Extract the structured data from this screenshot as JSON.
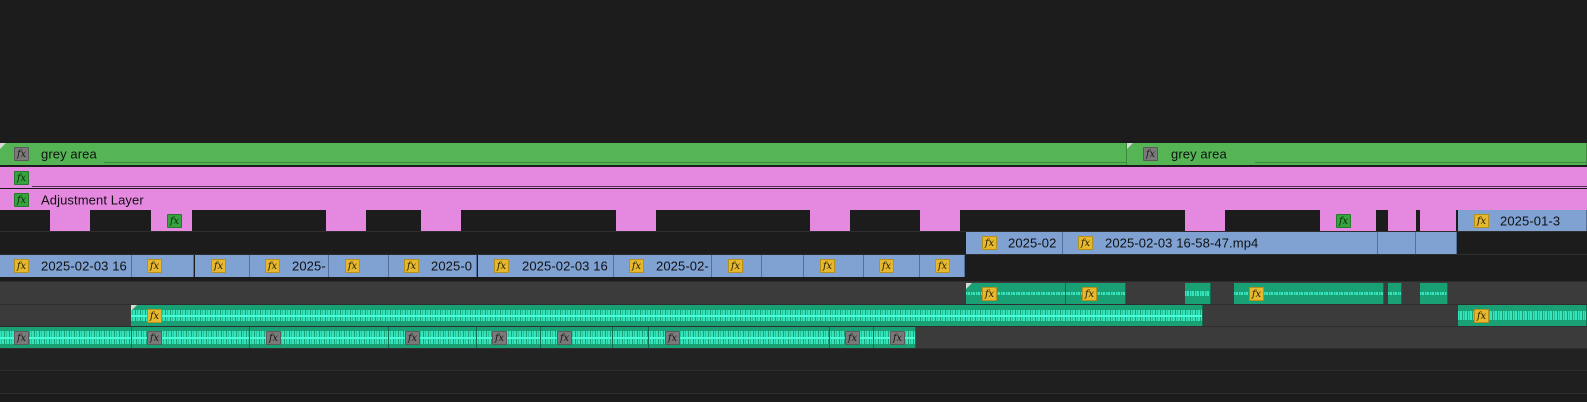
{
  "colors": {
    "background": "#1c1c1c",
    "track_audio_bg": "#3b3b3b",
    "clip_green": "#55b555",
    "clip_pink": "#e588e0",
    "clip_blue": "#7fa2d2",
    "clip_audio": "#1aa075",
    "fx_gray": "#7a7a7a",
    "fx_green": "#37a33f",
    "fx_yellow": "#e6b830"
  },
  "tracks": {
    "v6": {
      "clips": [
        {
          "label": "grey area",
          "fx": "gray"
        },
        {
          "label": "grey area",
          "fx": "gray"
        }
      ]
    },
    "v5": {
      "clips": [
        {
          "label": "",
          "fx": "green"
        }
      ]
    },
    "v4": {
      "clips": [
        {
          "label": "Adjustment Layer",
          "fx": "green"
        }
      ]
    },
    "v3": {
      "clips": [
        {
          "label": "",
          "fx": ""
        },
        {
          "label": "",
          "fx": "green"
        },
        {
          "label": "",
          "fx": ""
        },
        {
          "label": "",
          "fx": ""
        },
        {
          "label": "",
          "fx": ""
        },
        {
          "label": "",
          "fx": ""
        },
        {
          "label": "",
          "fx": ""
        },
        {
          "label": "",
          "fx": ""
        },
        {
          "label": "",
          "fx": "green"
        },
        {
          "label": "",
          "fx": ""
        },
        {
          "label": "",
          "fx": ""
        },
        {
          "label": "2025-01-3",
          "fx": "yellow"
        }
      ]
    },
    "v2": {
      "clips": [
        {
          "label": "2025-02",
          "fx": "yellow"
        },
        {
          "label": "2025-02-03 16-58-47.mp4",
          "fx": "yellow"
        },
        {
          "label": "",
          "fx": ""
        },
        {
          "label": "",
          "fx": ""
        }
      ]
    },
    "v1": {
      "clips": [
        {
          "label": "2025-02-03 16",
          "fx": "yellow"
        },
        {
          "label": "",
          "fx": "yellow"
        },
        {
          "label": "",
          "fx": "yellow"
        },
        {
          "label": "2025-",
          "fx": "yellow"
        },
        {
          "label": "",
          "fx": "yellow"
        },
        {
          "label": "2025-0",
          "fx": "yellow"
        },
        {
          "label": "2025-02-03 16",
          "fx": "yellow"
        },
        {
          "label": "2025-02-",
          "fx": "yellow"
        },
        {
          "label": "",
          "fx": "yellow"
        },
        {
          "label": "",
          "fx": ""
        },
        {
          "label": "",
          "fx": "yellow"
        },
        {
          "label": "",
          "fx": "yellow"
        },
        {
          "label": "",
          "fx": "yellow"
        }
      ]
    },
    "a1": {
      "clips": [
        {
          "fx": "yellow"
        },
        {
          "fx": "yellow"
        },
        {
          "fx": ""
        },
        {
          "fx": "yellow"
        },
        {
          "fx": ""
        },
        {
          "fx": ""
        }
      ]
    },
    "a2": {
      "clips": [
        {
          "fx": "yellow"
        },
        {
          "fx": "yellow"
        }
      ]
    },
    "a3": {
      "clips": [
        {
          "fx": "gray"
        },
        {
          "fx": "gray"
        },
        {
          "fx": "gray"
        },
        {
          "fx": "gray"
        },
        {
          "fx": "gray"
        },
        {
          "fx": "gray"
        },
        {
          "fx": ""
        },
        {
          "fx": "gray"
        },
        {
          "fx": "gray"
        },
        {
          "fx": "gray"
        }
      ]
    }
  }
}
